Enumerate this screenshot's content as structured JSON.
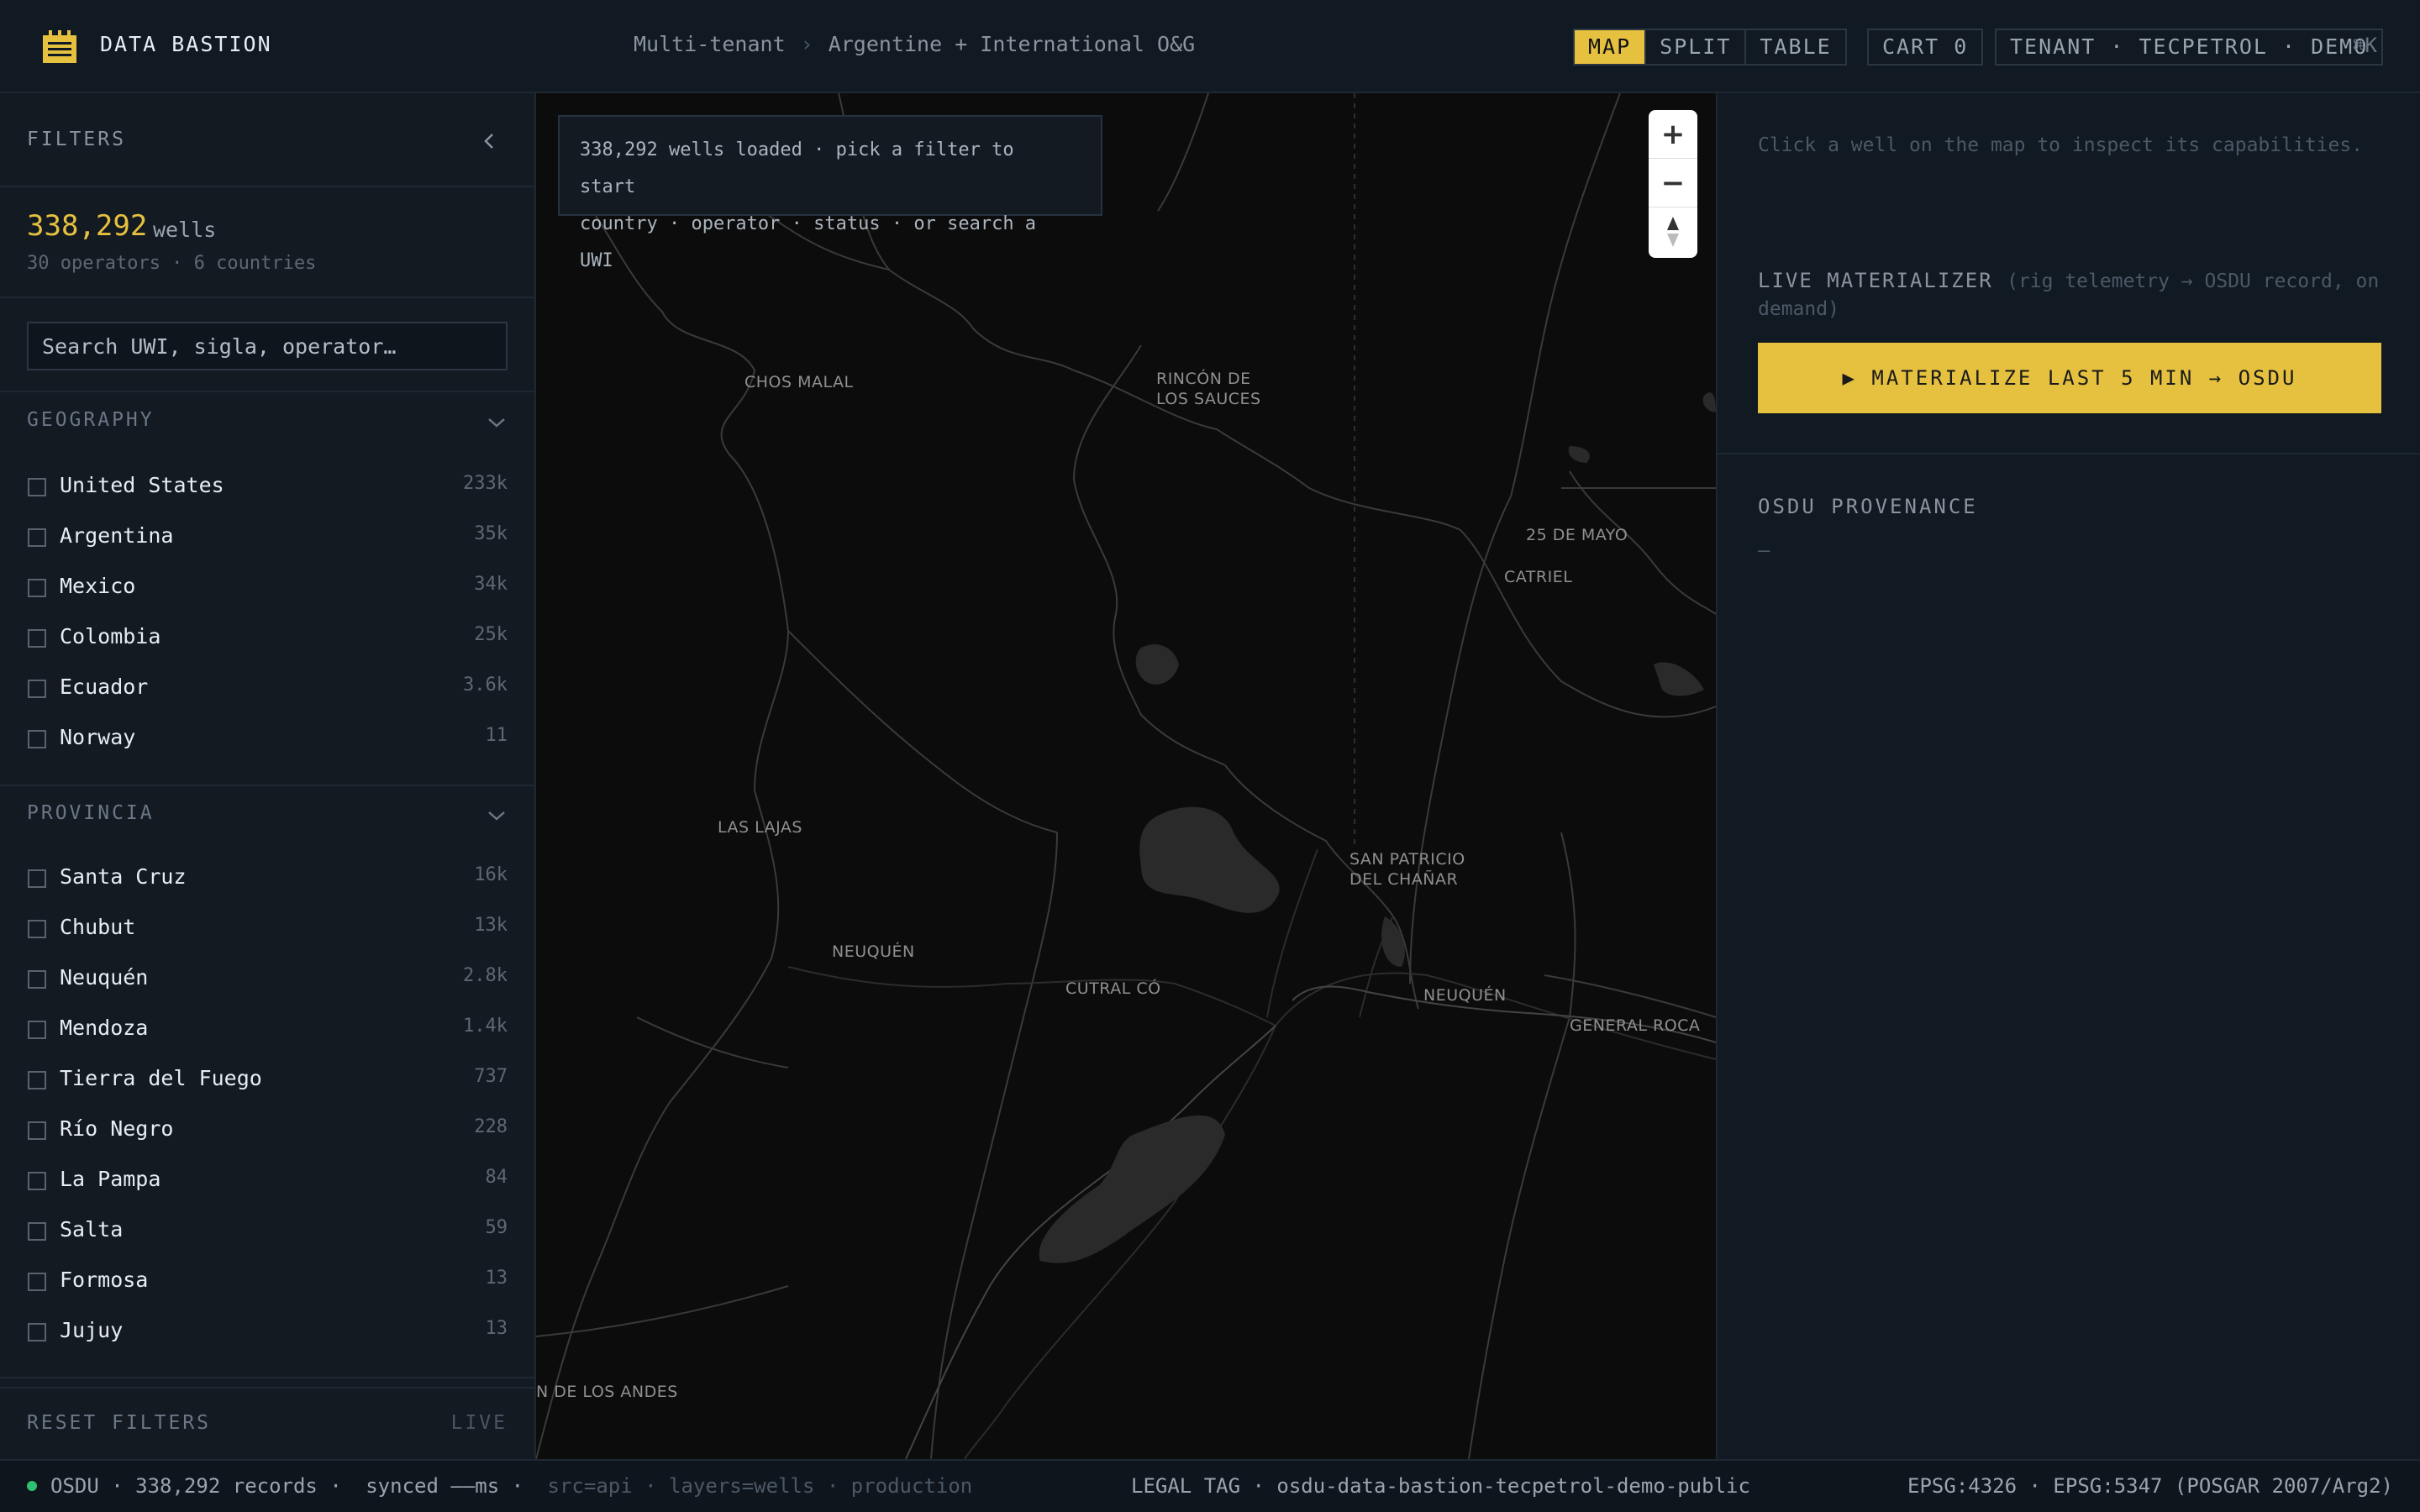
{
  "app": {
    "title": "DATA BASTION",
    "logo_icon": "server-rack-icon",
    "accent_color": "#e6c13f"
  },
  "header": {
    "breadcrumb": [
      "Multi-tenant",
      "Argentine + International O&G"
    ],
    "breadcrumb_sep": "›",
    "view_modes": [
      {
        "label": "MAP",
        "active": true
      },
      {
        "label": "SPLIT",
        "active": false
      },
      {
        "label": "TABLE",
        "active": false
      }
    ],
    "cart_label": "CART 0",
    "tenant_label": "TENANT · TECPETROL · DEMO",
    "shortcut": "⌘K"
  },
  "sidebar": {
    "title": "FILTERS",
    "collapse_icon": "chevron-left-icon",
    "well_count": "338,292",
    "well_unit": "wells",
    "count_sub": "30 operators · 6 countries",
    "search_placeholder": "Search UWI, sigla, operator…",
    "geography": {
      "title": "GEOGRAPHY",
      "items": [
        {
          "label": "United States",
          "count": "233k"
        },
        {
          "label": "Argentina",
          "count": "35k"
        },
        {
          "label": "Mexico",
          "count": "34k"
        },
        {
          "label": "Colombia",
          "count": "25k"
        },
        {
          "label": "Ecuador",
          "count": "3.6k"
        },
        {
          "label": "Norway",
          "count": "11"
        }
      ]
    },
    "provincia": {
      "title": "PROVINCIA",
      "items": [
        {
          "label": "Santa Cruz",
          "count": "16k"
        },
        {
          "label": "Chubut",
          "count": "13k"
        },
        {
          "label": "Neuquén",
          "count": "2.8k"
        },
        {
          "label": "Mendoza",
          "count": "1.4k"
        },
        {
          "label": "Tierra del Fuego",
          "count": "737"
        },
        {
          "label": "Río Negro",
          "count": "228"
        },
        {
          "label": "La Pampa",
          "count": "84"
        },
        {
          "label": "Salta",
          "count": "59"
        },
        {
          "label": "Formosa",
          "count": "13"
        },
        {
          "label": "Jujuy",
          "count": "13"
        }
      ]
    },
    "reset_label": "RESET FILTERS",
    "live_label": "LIVE"
  },
  "map": {
    "banner_line1": "338,292 wells loaded · pick a filter to start",
    "banner_line2": "country · operator · status · or search a UWI",
    "zoom_in": "+",
    "zoom_out": "−",
    "labels": {
      "chos_malal": "CHOS MALAL",
      "rincon_1": "RINCÓN DE",
      "rincon_2": "LOS SAUCES",
      "veinticinco": "25 DE MAYO",
      "catriel": "CATRIEL",
      "las_lajas": "LAS LAJAS",
      "san_patricio_1": "SAN PATRICIO",
      "san_patricio_2": "DEL CHAÑAR",
      "neuquen_prov": "NEUQUÉN",
      "cutral_co": "CUTRAL CÓ",
      "neuquen_city": "NEUQUÉN",
      "general_roca": "GENERAL ROCA",
      "andes": "N DE LOS ANDES"
    }
  },
  "panel": {
    "inspect_hint": "Click a well on the map to inspect its capabilities.",
    "materializer_title": "LIVE MATERIALIZER",
    "materializer_sub": "(rig telemetry → OSDU record, on demand)",
    "materialize_button": "▶ MATERIALIZE LAST 5 MIN → OSDU",
    "provenance_title": "OSDU PROVENANCE",
    "provenance_value": "—"
  },
  "status": {
    "osdu": "OSDU · 338,292 records ·",
    "synced": "synced ——ms ·",
    "meta": "src=api · layers=wells · production",
    "legal": "LEGAL TAG · osdu-data-bastion-tecpetrol-demo-public",
    "epsg": "EPSG:4326 · EPSG:5347 (POSGAR 2007/Arg2)",
    "status_color": "#2fbf71"
  }
}
